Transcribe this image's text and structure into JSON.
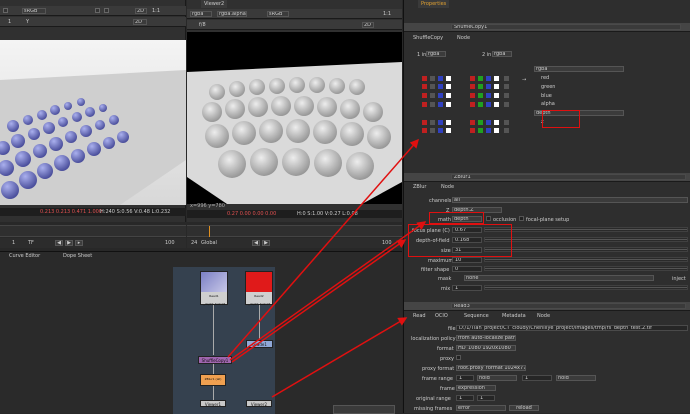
{
  "viewer_left": {
    "colorspace": "sRGB",
    "zoom": "1:1",
    "mode": "2D",
    "frame": "1",
    "checker_label": "Y",
    "gain": "1",
    "status": "0.213  0.213  0.471  1.000",
    "hsv": "H:240 S:0.56 V:0.48  L:0.232"
  },
  "viewer_right": {
    "tab": "Viewer2",
    "channels": "rgba",
    "alpha": "rgba.alpha",
    "colorspace": "sRGB",
    "zoom": "1:1",
    "mode": "2D",
    "fstop": "f/8",
    "frame": "1",
    "gain": "1",
    "coords": "x=996 y=780",
    "status": "0.27  0.00  0.00  0.00",
    "hsv": "H:0 S:1.00 V:0.27  L:0.08"
  },
  "timeline": {
    "ticks": [
      "1",
      "10",
      "20",
      "30",
      "40",
      "50",
      "60",
      "70",
      "80",
      "90",
      "100"
    ],
    "start": "1",
    "end": "100",
    "fps": "24",
    "tf": "TF",
    "global": "Global"
  },
  "node_graph": {
    "tabs": [
      "Curve Editor",
      "Dope Sheet"
    ],
    "nodes": {
      "read_a": "Read1\n_depth_test.tif",
      "read_b": "Read2\n_depth_test.tif",
      "shuffle": "ShuffleCopy1",
      "grade": "Grade1",
      "zblur": "ZBlur1\n(all)",
      "viewer1": "Viewer1",
      "viewer2": "Viewer2"
    }
  },
  "properties_tab": "Properties",
  "shuffle": {
    "node_name": "ShuffleCopy1",
    "tabs": [
      "ShuffleCopy",
      "Node"
    ],
    "in1_label": "1 in",
    "in1": "rgba",
    "in2_label": "2 in",
    "in2": "rgba",
    "out_layer": "rgba",
    "out_channels": [
      "red",
      "green",
      "blue",
      "alpha"
    ],
    "out2_layer": "depth",
    "out2_channel": "z"
  },
  "zblur": {
    "node_name": "ZBlur1",
    "tabs": [
      "ZBlur",
      "Node"
    ],
    "channels_label": "channels",
    "channels": "all",
    "z_label": "Z",
    "z": "depth.Z",
    "math_label": "math",
    "math": "depth",
    "occlusion_label": "occlusion",
    "focal_setup_label": "focal-plane setup",
    "focus_label": "focus plane (C)",
    "focus": "0.67",
    "dof_label": "depth-of-field",
    "dof": "0.168",
    "size_label": "size",
    "size": "31",
    "maximum_label": "maximum",
    "maximum": "10",
    "filter_label": "filter shape",
    "filter": "0",
    "mask_label": "mask",
    "mask": "none",
    "inject_label": "inject",
    "mix_label": "mix",
    "mix": "1"
  },
  "read3": {
    "node_name": "Read3",
    "tabs": [
      "Read",
      "OCIO",
      "Sequence",
      "Metadata",
      "Node"
    ],
    "file_label": "file",
    "file": "D:/1/Tian_project/CT_cloudy/Chenlliye_project/images/tmp/rs_depth_test.2.tif",
    "localization_label": "localization policy",
    "localization": "from auto-localize path",
    "format_label": "format",
    "format": "HD_1080 1920x1080",
    "proxy_label": "proxy",
    "proxy_format_label": "proxy format",
    "proxy_format": "root.proxy_format 1024x778",
    "frame_range_label": "frame range",
    "fr_start": "1",
    "fr_mode_a": "hold",
    "fr_end": "1",
    "fr_mode_b": "hold",
    "frame_label": "frame",
    "frame": "expression",
    "original_range_label": "original range",
    "or_start": "1",
    "or_end": "1",
    "missing_label": "missing frames",
    "missing": "error",
    "reload": "reload"
  }
}
